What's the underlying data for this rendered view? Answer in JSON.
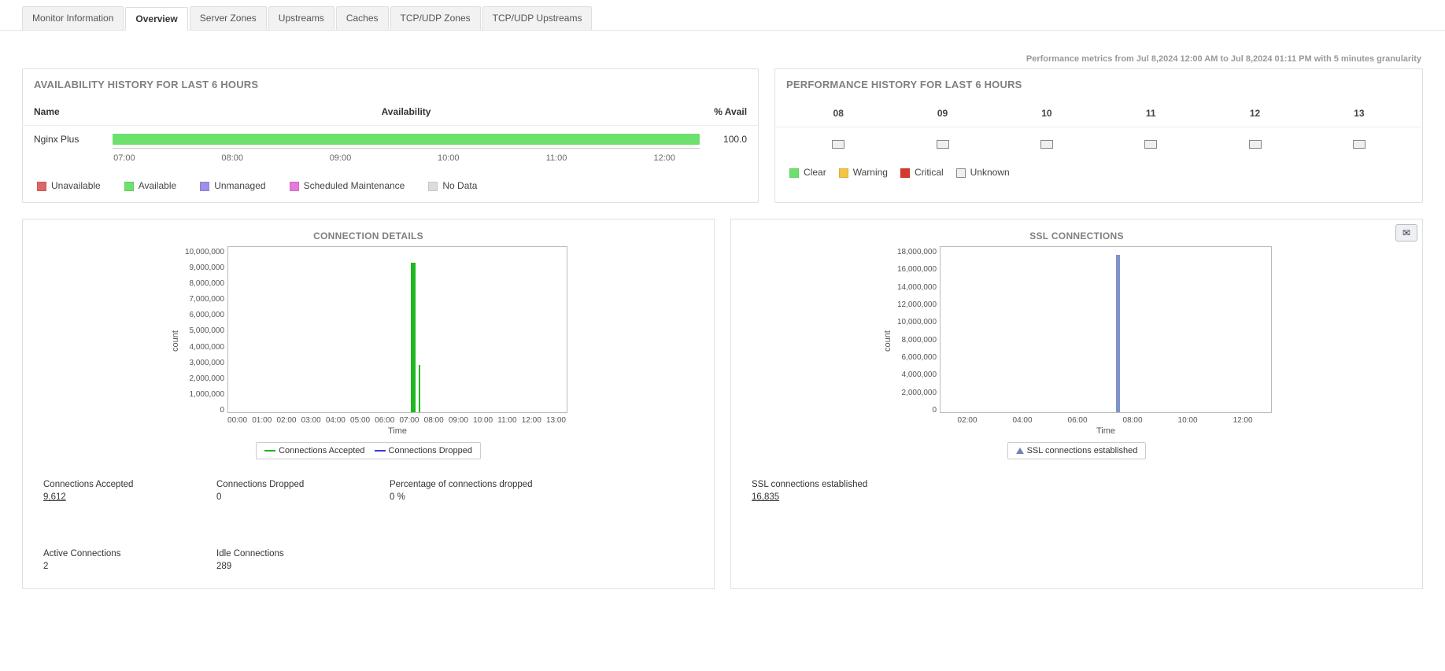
{
  "tabs": [
    "Monitor Information",
    "Overview",
    "Server Zones",
    "Upstreams",
    "Caches",
    "TCP/UDP Zones",
    "TCP/UDP Upstreams"
  ],
  "active_tab": 1,
  "meta": "Performance metrics from Jul 8,2024 12:00 AM to Jul 8,2024 01:11 PM with 5 minutes granularity",
  "availability": {
    "title": "AVAILABILITY HISTORY FOR LAST 6 HOURS",
    "cols": {
      "name": "Name",
      "avail": "Availability",
      "pct": "% Avail"
    },
    "row": {
      "name": "Nginx Plus",
      "pct": "100.0"
    },
    "ticks": [
      "07:00",
      "08:00",
      "09:00",
      "10:00",
      "11:00",
      "12:00"
    ],
    "legend": [
      {
        "label": "Unavailable",
        "color": "#e06666"
      },
      {
        "label": "Available",
        "color": "#6ce26c"
      },
      {
        "label": "Unmanaged",
        "color": "#9f8fe8"
      },
      {
        "label": "Scheduled Maintenance",
        "color": "#e879d8"
      },
      {
        "label": "No Data",
        "color": "#dcdcdc"
      }
    ]
  },
  "performance": {
    "title": "PERFORMANCE HISTORY FOR LAST 6 HOURS",
    "hours": [
      "08",
      "09",
      "10",
      "11",
      "12",
      "13"
    ],
    "legend": [
      {
        "label": "Clear",
        "color": "#6ce26c"
      },
      {
        "label": "Warning",
        "color": "#f4c542"
      },
      {
        "label": "Critical",
        "color": "#d63a2f"
      },
      {
        "label": "Unknown",
        "color": "#efefef",
        "border": "#888"
      }
    ]
  },
  "connection": {
    "title": "CONNECTION DETAILS",
    "ylabel": "count",
    "xlabel": "Time",
    "yticks": [
      "10,000,000",
      "9,000,000",
      "8,000,000",
      "7,000,000",
      "6,000,000",
      "5,000,000",
      "4,000,000",
      "3,000,000",
      "2,000,000",
      "1,000,000",
      "0"
    ],
    "xticks": [
      "00:00",
      "01:00",
      "02:00",
      "03:00",
      "04:00",
      "05:00",
      "06:00",
      "07:00",
      "08:00",
      "09:00",
      "10:00",
      "11:00",
      "12:00",
      "13:00"
    ],
    "legend": [
      {
        "label": "Connections Accepted",
        "color": "#1eb81e"
      },
      {
        "label": "Connections Dropped",
        "color": "#3b3bcf"
      }
    ],
    "stats": [
      {
        "label": "Connections Accepted",
        "value": "9,612",
        "u": true
      },
      {
        "label": "Connections Dropped",
        "value": "0"
      },
      {
        "label": "Percentage of connections dropped",
        "value": "0 %"
      },
      {
        "label": "Active Connections",
        "value": "2"
      },
      {
        "label": "Idle Connections",
        "value": "289"
      }
    ]
  },
  "ssl": {
    "title": "SSL CONNECTIONS",
    "ylabel": "count",
    "xlabel": "Time",
    "yticks": [
      "18,000,000",
      "16,000,000",
      "14,000,000",
      "12,000,000",
      "10,000,000",
      "8,000,000",
      "6,000,000",
      "4,000,000",
      "2,000,000",
      "0"
    ],
    "xticks": [
      "02:00",
      "04:00",
      "06:00",
      "08:00",
      "10:00",
      "12:00"
    ],
    "legend_label": "SSL connections established",
    "stat": {
      "label": "SSL connections established",
      "value": "16,835"
    }
  },
  "chart_data": [
    {
      "type": "bar",
      "title": "Availability",
      "categories": [
        "07:00",
        "08:00",
        "09:00",
        "10:00",
        "11:00",
        "12:00"
      ],
      "series": [
        {
          "name": "Nginx Plus",
          "values": [
            100,
            100,
            100,
            100,
            100,
            100
          ]
        }
      ],
      "y_unit": "% availability"
    },
    {
      "type": "line",
      "title": "CONNECTION DETAILS",
      "xlabel": "Time",
      "ylabel": "count",
      "ylim": [
        0,
        10000000
      ],
      "x": [
        "00:00",
        "01:00",
        "02:00",
        "03:00",
        "04:00",
        "05:00",
        "06:00",
        "07:00",
        "08:00",
        "09:00",
        "10:00",
        "11:00",
        "12:00",
        "13:00"
      ],
      "series": [
        {
          "name": "Connections Accepted",
          "values": [
            0,
            0,
            0,
            0,
            0,
            0,
            0,
            9000000,
            0,
            0,
            0,
            0,
            0,
            0
          ]
        },
        {
          "name": "Connections Dropped",
          "values": [
            0,
            0,
            0,
            0,
            0,
            0,
            0,
            0,
            0,
            0,
            0,
            0,
            0,
            0
          ]
        }
      ]
    },
    {
      "type": "area",
      "title": "SSL CONNECTIONS",
      "xlabel": "Time",
      "ylabel": "count",
      "ylim": [
        0,
        18000000
      ],
      "x": [
        "02:00",
        "04:00",
        "06:00",
        "07:00",
        "08:00",
        "10:00",
        "12:00"
      ],
      "series": [
        {
          "name": "SSL connections established",
          "values": [
            0,
            0,
            0,
            16000000,
            0,
            0,
            0
          ]
        }
      ]
    }
  ]
}
